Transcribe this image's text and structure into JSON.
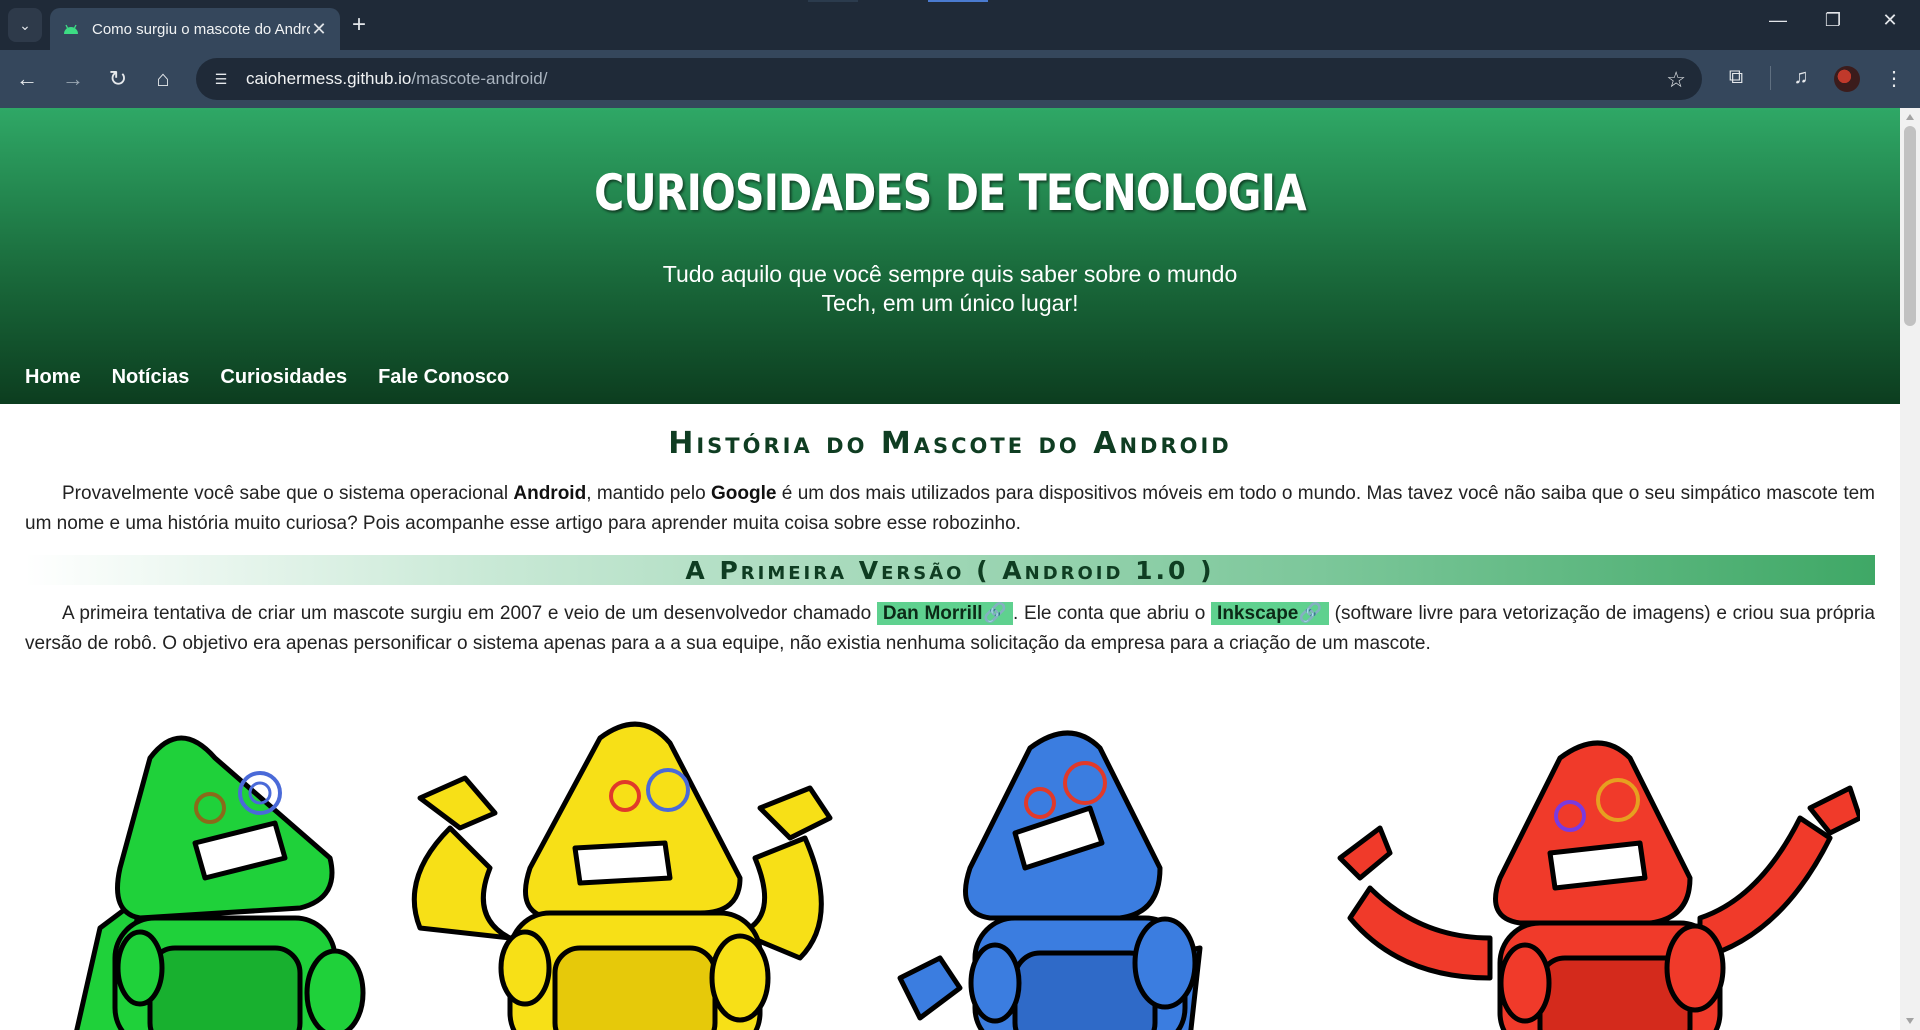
{
  "browser": {
    "tab_title": "Como surgiu o mascote do Android",
    "url_host": "caiohermess.github.io",
    "url_path": "/mascote-android/"
  },
  "site": {
    "title": "CURIOSIDADES DE TECNOLOGIA",
    "subtitle": "Tudo aquilo que você sempre quis saber sobre o mundo Tech, em um único lugar!",
    "nav": [
      "Home",
      "Notícias",
      "Curiosidades",
      "Fale Conosco"
    ]
  },
  "article": {
    "heading": "História do Mascote do Android",
    "intro": {
      "t1": "Provavelmente você sabe que o sistema operacional ",
      "b1": "Android",
      "t2": ", mantido pelo ",
      "b2": "Google",
      "t3": " é um dos mais utilizados para dispositivos móveis em todo o mundo. Mas tavez você não saiba que o seu simpático mascote tem um nome e uma história muito curiosa? Pois acompanhe esse artigo para aprender muita coisa sobre esse robozinho."
    },
    "section1": {
      "heading": "A Primeira Versão ( Android 1.0 )",
      "t1": "A primeira tentativa de criar um mascote surgiu em 2007 e veio de um desenvolvedor chamado ",
      "link1": "Dan Morrill🔗",
      "t2": ". Ele conta que abriu o ",
      "link2": "Inkscape🔗",
      "t3": " (software livre para vetorização de imagens) e criou sua própria versão de robô. O objetivo era apenas personificar o sistema apenas para a a sua equipe, não existia nenhuma solicitação da empresa para a criação de um mascote."
    }
  },
  "colors": {
    "header_top": "#2fa866",
    "header_bottom": "#0c3d1f",
    "heading_text": "#0f3d22",
    "link_pill": "#5fd18f",
    "robot_green": "#1fd13a",
    "robot_yellow": "#f7e017",
    "robot_blue": "#3b7de0",
    "robot_red": "#f03a2a"
  }
}
